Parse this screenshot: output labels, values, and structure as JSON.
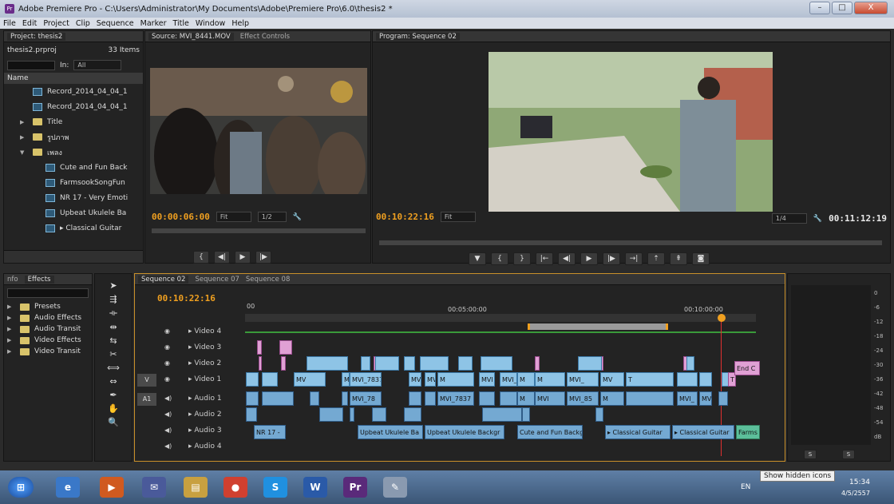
{
  "window": {
    "title": "Adobe Premiere Pro - C:\\Users\\Administrator\\My Documents\\Adobe\\Premiere Pro\\6.0\\thesis2 *",
    "minimize": "–",
    "maximize": "□",
    "close": "X"
  },
  "menu": [
    "File",
    "Edit",
    "Project",
    "Clip",
    "Sequence",
    "Marker",
    "Title",
    "Window",
    "Help"
  ],
  "project": {
    "tab": "Project: thesis2",
    "file": "thesis2.prproj",
    "count": "33 Items",
    "in_label": "In:",
    "in_value": "All",
    "name_header": "Name",
    "items": [
      {
        "name": "Record_2014_04_04_1",
        "type": "sequence"
      },
      {
        "name": "Record_2014_04_04_1",
        "type": "sequence"
      },
      {
        "name": "Title",
        "type": "folder"
      },
      {
        "name": "รูปภาพ",
        "type": "folder"
      },
      {
        "name": "เพลง",
        "type": "folder-open"
      },
      {
        "name": "Cute and Fun Back",
        "type": "sequence"
      },
      {
        "name": "FarmsookSongFun",
        "type": "sequence"
      },
      {
        "name": "NR 17 - Very Emoti",
        "type": "sequence"
      },
      {
        "name": "Upbeat Ukulele Ba",
        "type": "sequence"
      },
      {
        "name": "▸ Classical Guitar",
        "type": "sequence"
      }
    ]
  },
  "source": {
    "tab": "Source: MVI_8441.MOV",
    "tab2": "Effect Controls",
    "timecode": "00:00:06:00",
    "fit": "Fit",
    "res": "1/2"
  },
  "program": {
    "tab": "Program: Sequence 02",
    "timecode": "00:10:22:16",
    "fit": "Fit",
    "res": "1/4",
    "duration": "00:11:12:19"
  },
  "effects": {
    "tab_info": "nfo",
    "tab": "Effects",
    "items": [
      "Presets",
      "Audio Effects",
      "Audio Transit",
      "Video Effects",
      "Video Transit"
    ]
  },
  "timeline": {
    "tabs": [
      "Sequence 02",
      "Sequence 07",
      "Sequence 08"
    ],
    "timecode": "00:10:22:16",
    "ruler": [
      "00",
      "00:05:00:00",
      "00:10:00:00"
    ],
    "tracks": [
      {
        "label": "Video 4",
        "src": ""
      },
      {
        "label": "Video 3",
        "src": ""
      },
      {
        "label": "Video 2",
        "src": ""
      },
      {
        "label": "Video 1",
        "src": "V"
      },
      {
        "label": "Audio 1",
        "src": "A1"
      },
      {
        "label": "Audio 2",
        "src": ""
      },
      {
        "label": "Audio 3",
        "src": ""
      },
      {
        "label": "Audio 4",
        "src": ""
      }
    ],
    "clips": {
      "v1": [
        "MV",
        "MVI_78",
        "MVI_7837",
        "MV",
        "MVI_7837",
        "M",
        "MVI",
        "MVI_85",
        "M",
        "M",
        "MVI_",
        "MV",
        "T"
      ],
      "a1": [
        "MVI_78",
        "MVI_7837",
        "M",
        "MVI",
        "MVI_85",
        "M",
        "MVI_",
        "MV"
      ],
      "a3": [
        "NR 17 -",
        "Upbeat Ukulele Ba",
        "Upbeat Ukulele Backgr",
        "Cute and Fun Backg",
        "▸ Classical Guitar",
        "▸ Classical Guitar",
        "Farms"
      ],
      "end": "End C"
    }
  },
  "meter": {
    "ticks": [
      "0",
      "-6",
      "-12",
      "-18",
      "-24",
      "-30",
      "-36",
      "-42",
      "-48",
      "-54",
      "dB"
    ],
    "solo": [
      "S",
      "S"
    ]
  },
  "taskbar": {
    "tooltip": "Show hidden icons",
    "lang": "EN",
    "time": "15:34",
    "date": "4/5/2557",
    "apps": [
      "ie",
      "media-player",
      "mail",
      "files",
      "chrome",
      "skype",
      "word",
      "premiere",
      "paint"
    ]
  }
}
